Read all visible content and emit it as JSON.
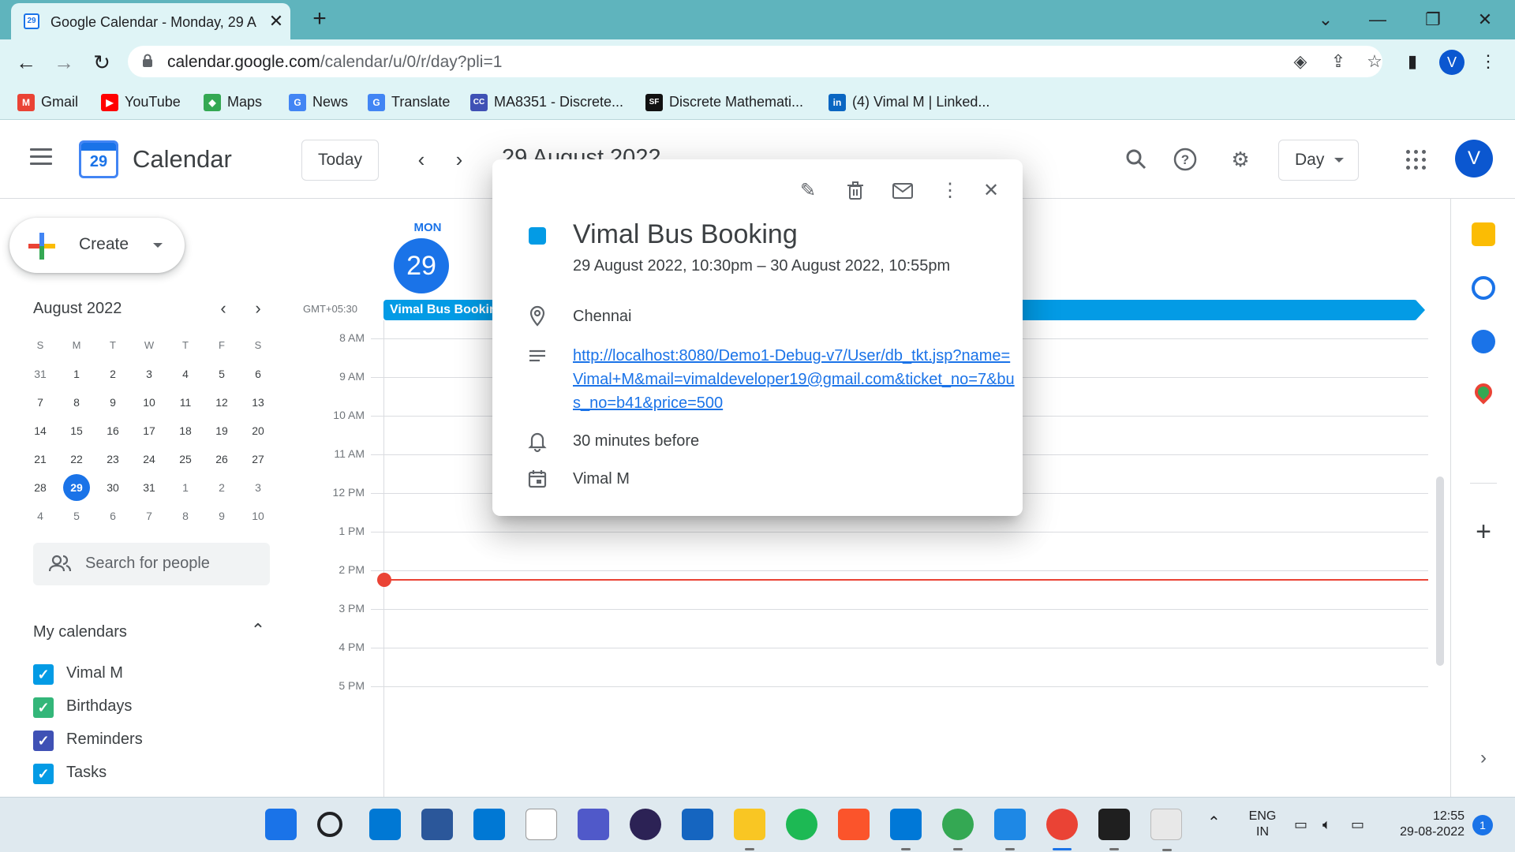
{
  "browser": {
    "tab_title": "Google Calendar - Monday, 29 A",
    "tab_favicon": "29",
    "url_host": "calendar.google.com",
    "url_path": "/calendar/u/0/r/day?pli=1",
    "profile_initial": "V",
    "bookmarks": [
      {
        "label": "Gmail",
        "icon": "gmail-icon",
        "color": "#ea4335",
        "glyph": "M"
      },
      {
        "label": "YouTube",
        "icon": "youtube-icon",
        "color": "#ff0000",
        "glyph": "▶"
      },
      {
        "label": "Maps",
        "icon": "maps-icon",
        "color": "#34a853",
        "glyph": "◆"
      },
      {
        "label": "News",
        "icon": "news-icon",
        "color": "#4285f4",
        "glyph": "G"
      },
      {
        "label": "Translate",
        "icon": "translate-icon",
        "color": "#4285f4",
        "glyph": "G"
      },
      {
        "label": "MA8351 - Discrete...",
        "icon": "course-icon",
        "color": "#3f51b5",
        "glyph": "CC"
      },
      {
        "label": "Discrete Mathemati...",
        "icon": "sf-icon",
        "color": "#111111",
        "glyph": "SF"
      },
      {
        "label": "(4) Vimal M | Linked...",
        "icon": "linkedin-icon",
        "color": "#0a66c2",
        "glyph": "in"
      }
    ]
  },
  "calendar_header": {
    "logo_day": "29",
    "app_title": "Calendar",
    "today_label": "Today",
    "date_title": "29 August 2022",
    "view_label": "Day",
    "profile_initial": "V"
  },
  "sidebar": {
    "create_label": "Create",
    "mini_calendar": {
      "title": "August 2022",
      "weekdays": [
        "S",
        "M",
        "T",
        "W",
        "T",
        "F",
        "S"
      ],
      "weeks": [
        [
          "31",
          "1",
          "2",
          "3",
          "4",
          "5",
          "6"
        ],
        [
          "7",
          "8",
          "9",
          "10",
          "11",
          "12",
          "13"
        ],
        [
          "14",
          "15",
          "16",
          "17",
          "18",
          "19",
          "20"
        ],
        [
          "21",
          "22",
          "23",
          "24",
          "25",
          "26",
          "27"
        ],
        [
          "28",
          "29",
          "30",
          "31",
          "1",
          "2",
          "3"
        ],
        [
          "4",
          "5",
          "6",
          "7",
          "8",
          "9",
          "10"
        ]
      ],
      "today": "29"
    },
    "search_people_placeholder": "Search for people",
    "my_calendars_title": "My calendars",
    "calendars": [
      {
        "label": "Vimal M",
        "color": "#039be5"
      },
      {
        "label": "Birthdays",
        "color": "#33b679"
      },
      {
        "label": "Reminders",
        "color": "#3f51b5"
      },
      {
        "label": "Tasks",
        "color": "#039be5"
      }
    ]
  },
  "day_view": {
    "day_of_week": "MON",
    "day_number": "29",
    "timezone": "GMT+05:30",
    "allday_event": "Vimal Bus Booking",
    "hours": [
      "8 AM",
      "9 AM",
      "10 AM",
      "11 AM",
      "12 PM",
      "1 PM",
      "2 PM",
      "3 PM",
      "4 PM",
      "5 PM"
    ]
  },
  "event_popup": {
    "title": "Vimal Bus Booking",
    "time": "29 August 2022, 10:30pm – 30 August 2022, 10:55pm",
    "location": "Chennai",
    "description_link": "http://localhost:8080/Demo1-Debug-v7/User/db_tkt.jsp?name=Vimal+M&mail=vimaldeveloper19@gmail.com&ticket_no=7&bus_no=b41&price=500",
    "reminder": "30 minutes before",
    "calendar_owner": "Vimal M",
    "color": "#039be5"
  },
  "taskbar": {
    "language_top": "ENG",
    "language_bottom": "IN",
    "time": "12:55",
    "date": "29-08-2022",
    "notification_count": "1"
  }
}
